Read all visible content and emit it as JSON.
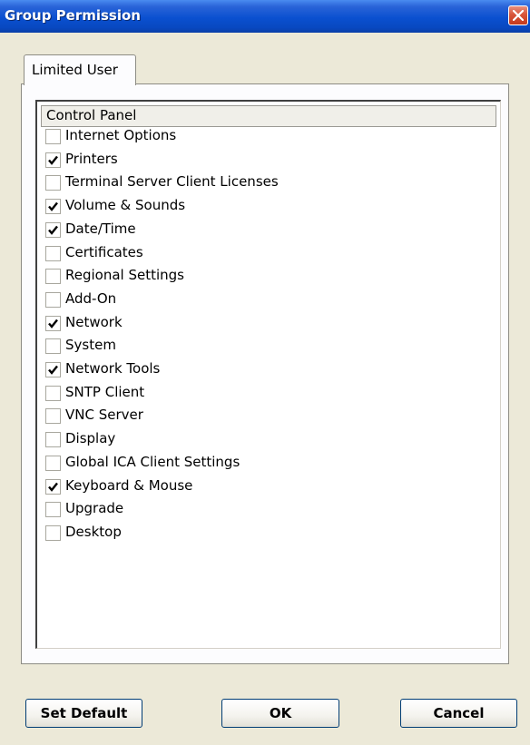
{
  "window": {
    "title": "Group Permission"
  },
  "tabs": [
    {
      "label": "Limited User",
      "selected": true
    }
  ],
  "list": {
    "header": "Control Panel",
    "items": [
      {
        "label": "Internet Options",
        "checked": false
      },
      {
        "label": "Printers",
        "checked": true
      },
      {
        "label": "Terminal Server Client Licenses",
        "checked": false
      },
      {
        "label": "Volume & Sounds",
        "checked": true
      },
      {
        "label": "Date/Time",
        "checked": true
      },
      {
        "label": "Certificates",
        "checked": false
      },
      {
        "label": "Regional Settings",
        "checked": false
      },
      {
        "label": "Add-On",
        "checked": false
      },
      {
        "label": "Network",
        "checked": true
      },
      {
        "label": "System",
        "checked": false
      },
      {
        "label": "Network Tools",
        "checked": true
      },
      {
        "label": "SNTP Client",
        "checked": false
      },
      {
        "label": "VNC Server",
        "checked": false
      },
      {
        "label": "Display",
        "checked": false
      },
      {
        "label": "Global ICA Client Settings",
        "checked": false
      },
      {
        "label": "Keyboard & Mouse",
        "checked": true
      },
      {
        "label": "Upgrade",
        "checked": false
      },
      {
        "label": "Desktop",
        "checked": false
      }
    ]
  },
  "buttons": {
    "set_default": "Set Default",
    "ok": "OK",
    "cancel": "Cancel"
  }
}
